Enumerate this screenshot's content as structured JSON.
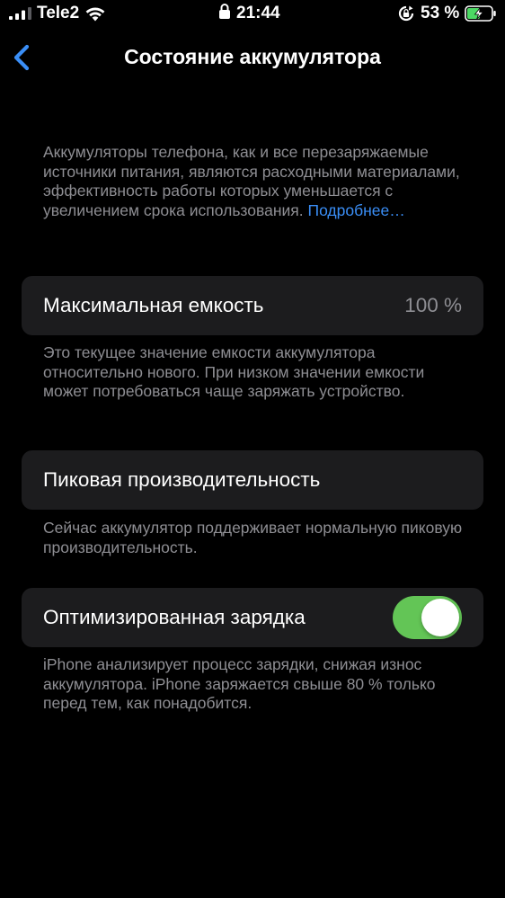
{
  "status_bar": {
    "carrier": "Tele2",
    "time": "21:44",
    "battery_percent": "53 %",
    "icons": [
      "signal-icon",
      "wifi-icon",
      "lock-icon",
      "rotation-lock-icon",
      "battery-charging-icon"
    ]
  },
  "nav": {
    "back_icon": "chevron-left-icon",
    "title": "Состояние аккумулятора"
  },
  "intro": {
    "text": "Аккумуляторы телефона, как и все перезаряжаемые источники питания, являются расходными материалами, эффективность работы которых уменьшается с увеличением срока использования.",
    "link": "Подробнее…"
  },
  "max_capacity": {
    "label": "Максимальная емкость",
    "value": "100 %",
    "footer": "Это текущее значение емкости аккумулятора относительно нового. При низком значении емкости может потребоваться чаще заряжать устройство."
  },
  "peak_performance": {
    "label": "Пиковая производительность",
    "footer": "Сейчас аккумулятор поддерживает нормальную пиковую производительность."
  },
  "optimized_charging": {
    "label": "Оптимизированная зарядка",
    "enabled": true,
    "footer": "iPhone анализирует процесс зарядки, снижая износ аккумулятора. iPhone заряжается свыше 80 % только перед тем, как понадобится."
  },
  "colors": {
    "background": "#000000",
    "cell": "#1c1c1e",
    "secondary_text": "#8e8e93",
    "accent": "#3a8ef6",
    "toggle_on": "#63c556",
    "battery_fill": "#4cd964"
  }
}
